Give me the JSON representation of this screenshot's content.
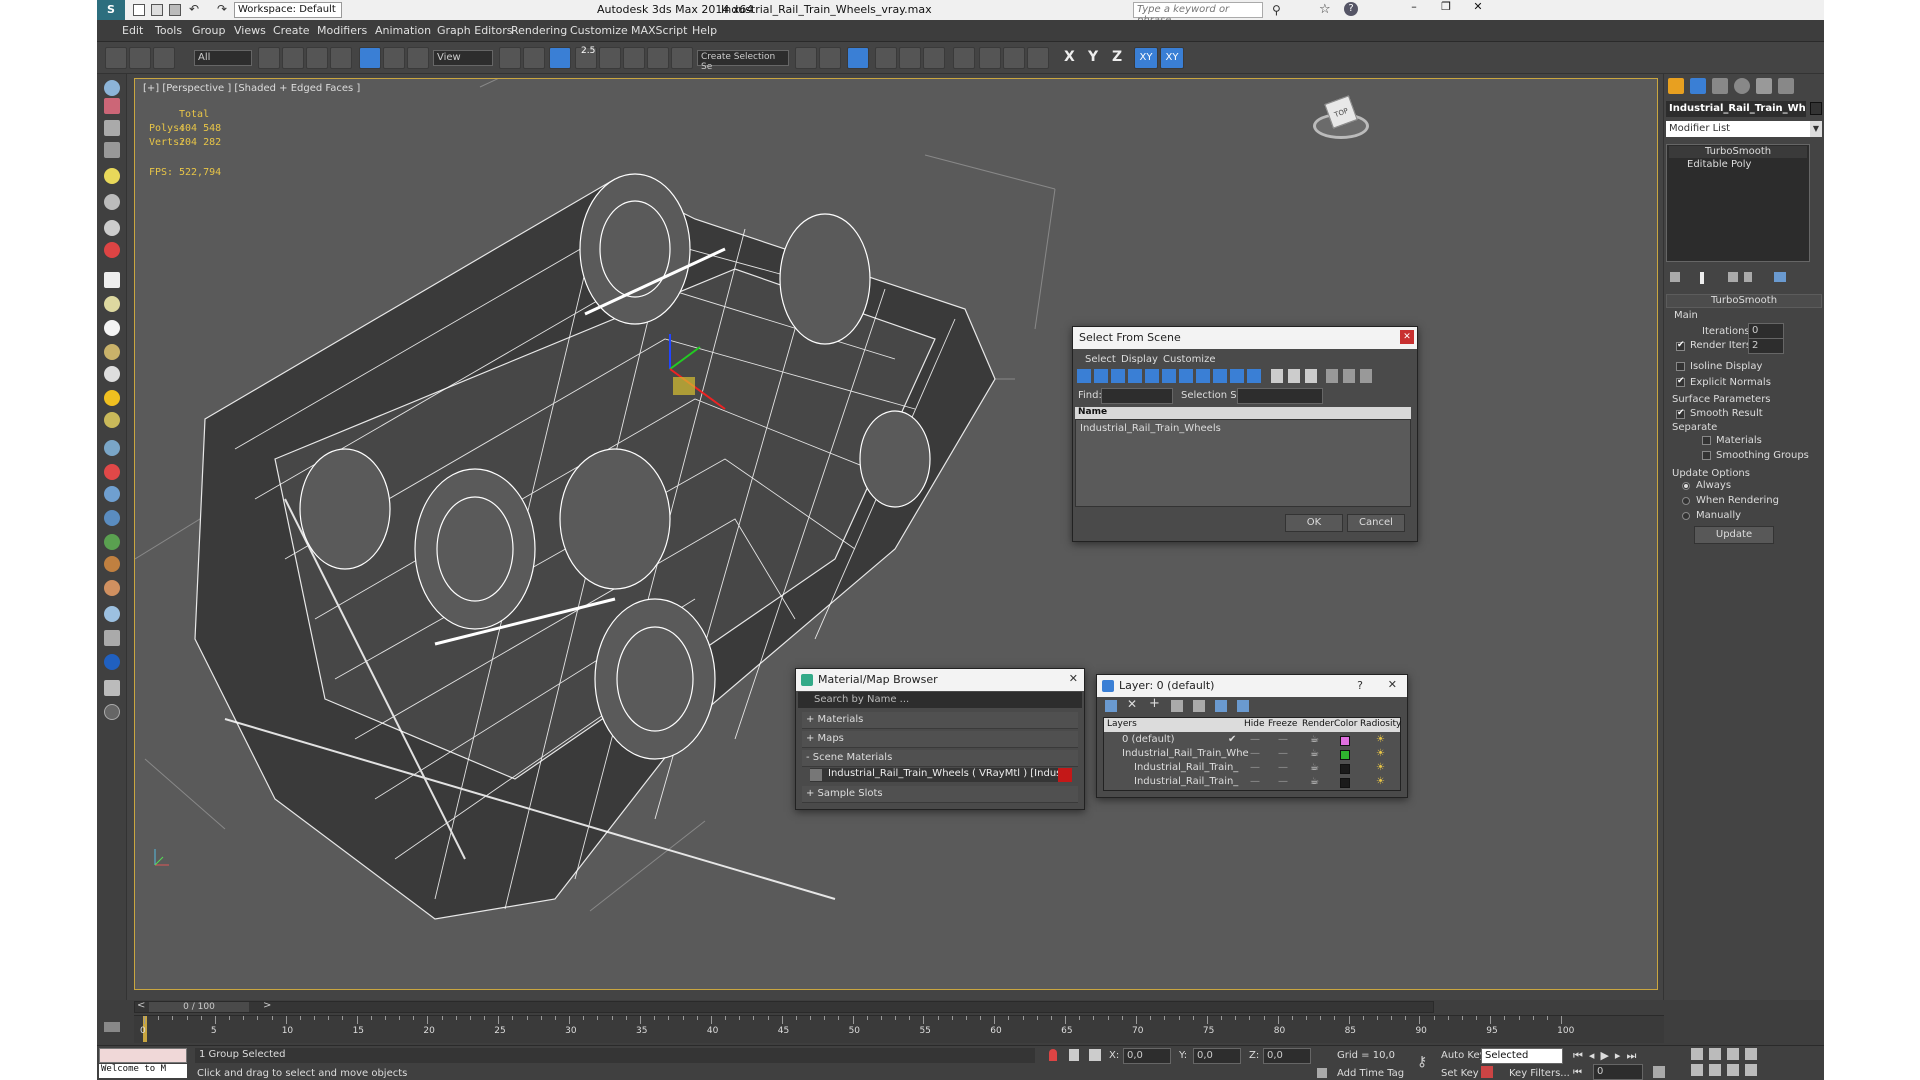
{
  "titlebar": {
    "workspace": "Workspace: Default",
    "app_title": "Autodesk 3ds Max  2014 x64",
    "file_name": "Industrial_Rail_Train_Wheels_vray.max",
    "search_placeholder": "Type a keyword or phrase"
  },
  "menu": [
    "Edit",
    "Tools",
    "Group",
    "Views",
    "Create",
    "Modifiers",
    "Animation",
    "Graph Editors",
    "Rendering",
    "Customize",
    "MAXScript",
    "Help"
  ],
  "toolbar": {
    "filter_value": "All",
    "ref_coord": "View",
    "selection_set_placeholder": "Create Selection Se",
    "snap_label": "2.5",
    "axis_x": "X",
    "axis_y": "Y",
    "axis_z": "Z",
    "axis_xy": "XY",
    "axis_xy2": "XY"
  },
  "viewport": {
    "label": "[+] [Perspective ] [Shaded + Edged Faces ]",
    "stats_header": "Total",
    "polys_label": "Polys:",
    "polys_value": "404 548",
    "verts_label": "Verts:",
    "verts_value": "204 282",
    "fps_label": "FPS:",
    "fps_value": "522,794",
    "viewcube_label": "TOP"
  },
  "right_panel": {
    "object_name": "Industrial_Rail_Train_Wh",
    "modifier_list": "Modifier List",
    "stack": [
      "TurboSmooth",
      "Editable Poly"
    ],
    "rollout_title": "TurboSmooth",
    "main_label": "Main",
    "iterations_label": "Iterations:",
    "iterations_value": "0",
    "render_iters_label": "Render Iters:",
    "render_iters_value": "2",
    "isoline_label": "Isoline Display",
    "explicit_normals_label": "Explicit Normals",
    "surface_params_label": "Surface Parameters",
    "smooth_result_label": "Smooth Result",
    "separate_label": "Separate",
    "materials_label": "Materials",
    "smoothing_groups_label": "Smoothing Groups",
    "update_options_label": "Update Options",
    "always_label": "Always",
    "when_rendering_label": "When Rendering",
    "manually_label": "Manually",
    "update_button": "Update"
  },
  "select_dialog": {
    "title": "Select From Scene",
    "menu": [
      "Select",
      "Display",
      "Customize"
    ],
    "find_label": "Find:",
    "selection_set_label": "Selection Set:",
    "column_name": "Name",
    "items": [
      "Industrial_Rail_Train_Wheels"
    ],
    "ok": "OK",
    "cancel": "Cancel"
  },
  "material_browser": {
    "title": "Material/Map Browser",
    "search_placeholder": "Search by Name ...",
    "sections": [
      "+ Materials",
      "+ Maps",
      "- Scene Materials"
    ],
    "scene_material": "Industrial_Rail_Train_Wheels  ( VRayMtl ) [Industrial_Rail_Train...",
    "sample_slots": "+ Sample Slots"
  },
  "layer_dialog": {
    "title": "Layer: 0 (default)",
    "help": "?",
    "columns": [
      "Layers",
      "Hide",
      "Freeze",
      "Render",
      "Color",
      "Radiosity"
    ],
    "rows": [
      {
        "name": "0 (default)",
        "color": "#e070e0"
      },
      {
        "name": "Industrial_Rail_Train_Whe",
        "color": "#2fb52f"
      },
      {
        "name": "Industrial_Rail_Train_",
        "color": "#1a1a1a"
      },
      {
        "name": "Industrial_Rail_Train_",
        "color": "#1a1a1a"
      }
    ]
  },
  "timeline": {
    "frame_counter": "0 / 100",
    "ticks": [
      "0",
      "5",
      "10",
      "15",
      "20",
      "25",
      "30",
      "35",
      "40",
      "45",
      "50",
      "55",
      "60",
      "65",
      "70",
      "75",
      "80",
      "85",
      "90",
      "95",
      "100"
    ]
  },
  "statusbar": {
    "maxscript": "Welcome to M",
    "selection": "1 Group Selected",
    "prompt": "Click and drag to select and move objects",
    "x_label": "X:",
    "x_value": "0,0",
    "y_label": "Y:",
    "y_value": "0,0",
    "z_label": "Z:",
    "z_value": "0,0",
    "grid": "Grid = 10,0",
    "add_time_tag": "Add Time Tag",
    "auto_key": "Auto Key",
    "set_key": "Set Key",
    "key_mode": "Selected",
    "key_filters": "Key Filters...",
    "frame": "0"
  },
  "colors": {
    "viewport_border": "#c9a640",
    "active_blue": "#3a7fd5",
    "stat_yellow": "#e8c547"
  }
}
